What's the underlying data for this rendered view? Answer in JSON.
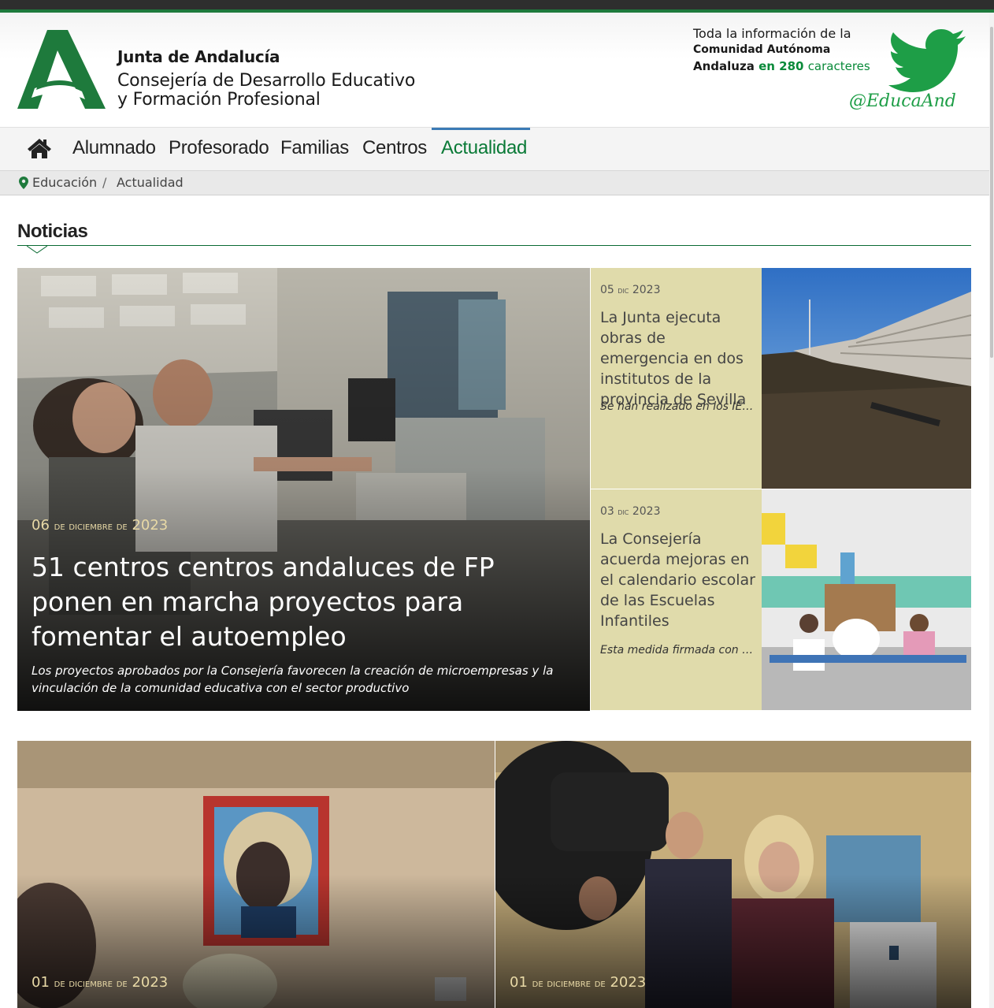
{
  "header": {
    "org_name": "Junta de Andalucía",
    "dept_line1": "Consejería de Desarrollo Educativo",
    "dept_line2": "y Formación Profesional",
    "twitter_line1": "Toda la información de la",
    "twitter_line2": "Comunidad Autónoma",
    "twitter_line3a": "Andaluza",
    "twitter_line3b": "en 280",
    "twitter_line3c": "caracteres",
    "twitter_handle": "@EducaAnd",
    "brand_green": "#1e7a3c"
  },
  "nav": {
    "items": [
      {
        "label": "Alumnado"
      },
      {
        "label": "Profesorado"
      },
      {
        "label": "Familias"
      },
      {
        "label": "Centros"
      },
      {
        "label": "Actualidad"
      }
    ],
    "active": "Actualidad",
    "home_icon": "home-icon"
  },
  "breadcrumb": {
    "home": "Educación",
    "separator": "/",
    "current": "Actualidad"
  },
  "section": {
    "title": "Noticias"
  },
  "feature": {
    "date_day": "06",
    "date_month": "de diciembre de",
    "date_year": "2023",
    "title": "51 centros centros andaluces de FP ponen en marcha proyectos para fomentar el autoempleo",
    "subtitle": "Los proyectos aprobados por la Consejería favorecen la creación de microempresas y la vinculación de la comunidad educativa con el sector productivo"
  },
  "side_news": [
    {
      "date_day": "05",
      "date_month": "dic",
      "date_year": "2023",
      "title": "La Junta ejecuta obras de emergencia en dos institutos de la provincia de Sevilla",
      "subtitle": "Se han realizado en los IES"
    },
    {
      "date_day": "03",
      "date_month": "dic",
      "date_year": "2023",
      "title": "La Consejería acuerda mejoras en el calendario escolar de las Escuelas Infantiles",
      "subtitle": "Esta medida firmada con los"
    }
  ],
  "bottom_news": [
    {
      "date_day": "01",
      "date_month": "de diciembre de",
      "date_year": "2023"
    },
    {
      "date_day": "01",
      "date_month": "de diciembre de",
      "date_year": "2023"
    }
  ]
}
